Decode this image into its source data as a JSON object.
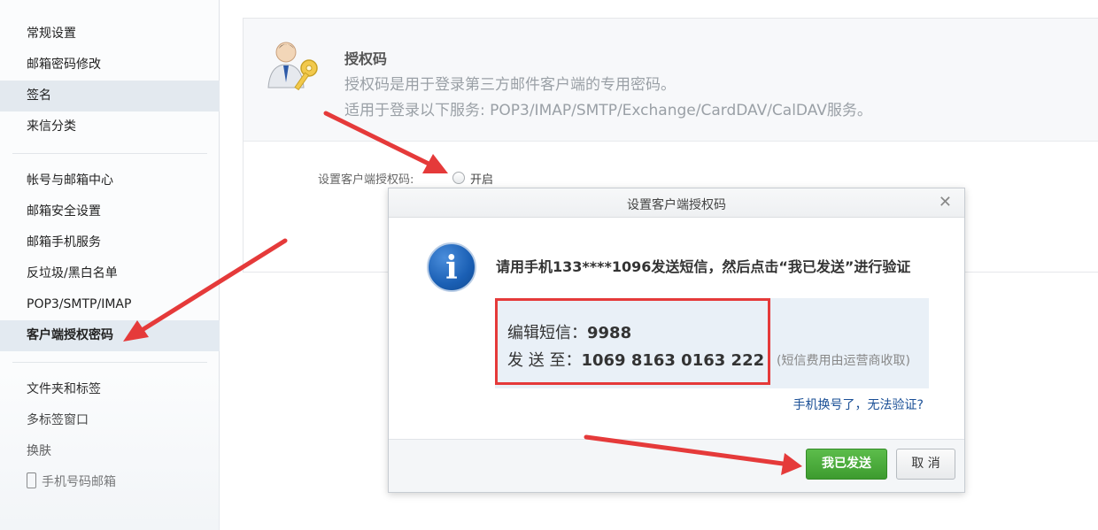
{
  "sidebar": {
    "items": [
      {
        "label": "常规设置"
      },
      {
        "label": "邮箱密码修改"
      },
      {
        "label": "签名"
      },
      {
        "label": "来信分类"
      },
      {
        "label": "帐号与邮箱中心"
      },
      {
        "label": "邮箱安全设置"
      },
      {
        "label": "邮箱手机服务"
      },
      {
        "label": "反垃圾/黑白名单"
      },
      {
        "label": "POP3/SMTP/IMAP"
      },
      {
        "label": "客户端授权密码"
      },
      {
        "label": "文件夹和标签"
      },
      {
        "label": "多标签窗口"
      },
      {
        "label": "换肤"
      },
      {
        "label": "手机号码邮箱"
      }
    ],
    "selected_item": "签名",
    "active_item": "客户端授权密码",
    "phone_icon": "phone-icon"
  },
  "main": {
    "title": "授权码",
    "desc1": "授权码是用于登录第三方邮件客户端的专用密码。",
    "desc2": "适用于登录以下服务: POP3/IMAP/SMTP/Exchange/CardDAV/CalDAV服务。",
    "setting_label": "设置客户端授权码:",
    "radio_label": "开启",
    "avatar_icon": "user-key-icon"
  },
  "dialog": {
    "title": "设置客户端授权码",
    "close_icon": "close-icon",
    "info_icon": "info-icon",
    "message": "请用手机133****1096发送短信，然后点击“我已发送”进行验证",
    "sms_label": "编辑短信：",
    "sms_value": "9988",
    "send_label": "发 送 至：",
    "send_value": "1069 8163 0163 222",
    "note": "(短信费用由运营商收取)",
    "help_link": "手机换号了，无法验证?",
    "confirm_label": "我已发送",
    "cancel_label": "取 消"
  },
  "colors": {
    "annotation_red": "#e53a3a",
    "confirm_green": "#4cab3c",
    "link_blue": "#1a4f96",
    "info_blue": "#1a5fb4"
  }
}
